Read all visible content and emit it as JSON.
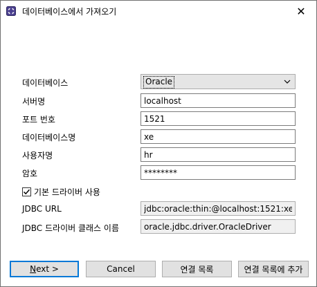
{
  "window": {
    "title": "데이터베이스에서 가져오기",
    "close_glyph": "✕"
  },
  "form": {
    "database": {
      "label": "데이터베이스",
      "value": "Oracle"
    },
    "server": {
      "label": "서버명",
      "value": "localhost"
    },
    "port": {
      "label": "포트 번호",
      "value": "1521"
    },
    "dbname": {
      "label": "데이터베이스명",
      "value": "xe"
    },
    "user": {
      "label": "사용자명",
      "value": "hr"
    },
    "password": {
      "label": "암호",
      "value": "********"
    },
    "default_driver": {
      "label": "기본 드라이버 사용",
      "checked": true
    },
    "jdbc_url": {
      "label": "JDBC URL",
      "value": "jdbc:oracle:thin:@localhost:1521:xe"
    },
    "driver_class": {
      "label": "JDBC 드라이버 클래스 이름",
      "value": "oracle.jdbc.driver.OracleDriver"
    }
  },
  "buttons": {
    "next_mnemonic": "N",
    "next_rest": "ext >",
    "cancel": "Cancel",
    "connection_list": "연결 목록",
    "add_to_list": "연결 목록에 추가"
  },
  "colors": {
    "default_button_border": "#0078d7",
    "button_bg": "#e1e1e1",
    "readonly_bg": "#f0f0f0"
  },
  "icons": {
    "app": "app-icon",
    "close": "close-icon",
    "dropdown": "chevron-down-icon",
    "check": "checkmark-icon"
  }
}
